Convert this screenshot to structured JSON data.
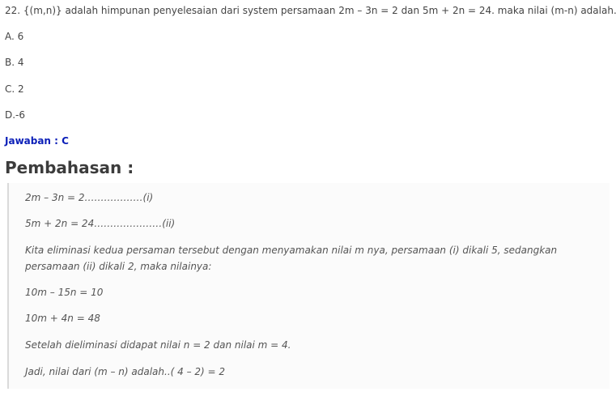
{
  "question": {
    "text": "22. {(m,n)} adalah himpunan penyelesaian dari system persamaan 2m – 3n = 2 dan 5m + 2n = 24. maka nilai (m-n) adalah…",
    "options": [
      "A. 6",
      "B. 4",
      "C. 2",
      "D.-6"
    ]
  },
  "answer": "Jawaban : C",
  "discussion": {
    "heading": "Pembahasan :",
    "lines": [
      "2m – 3n = 2………………(i)",
      "5m + 2n = 24…………………(ii)",
      "Kita eliminasi kedua persaman tersebut dengan menyamakan nilai m nya, persamaan (i) dikali 5, sedangkan persamaan (ii) dikali 2, maka nilainya:",
      "10m – 15n = 10",
      "10m + 4n = 48",
      "Setelah dieliminasi didapat nilai n = 2 dan nilai m = 4.",
      "Jadi, nilai dari (m – n) adalah..( 4 – 2) = 2"
    ]
  }
}
